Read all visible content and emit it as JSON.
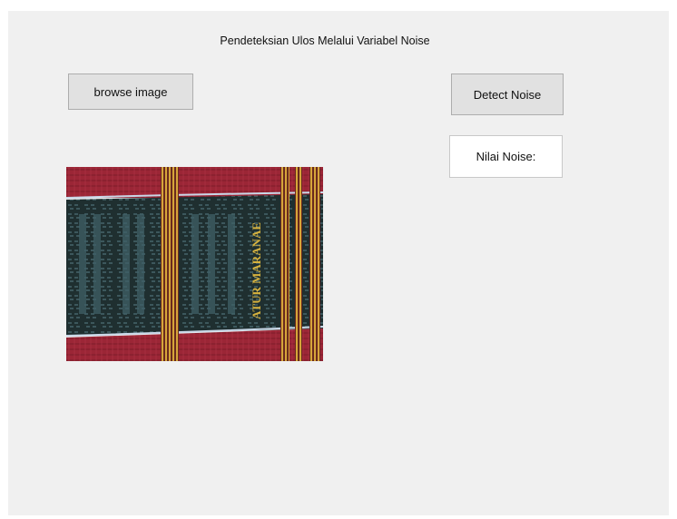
{
  "window": {
    "title": "Pendeteksian Ulos Melalui Variabel Noise"
  },
  "buttons": {
    "browse_label": "browse image",
    "detect_label": "Detect Noise"
  },
  "result": {
    "label": "Nilai Noise:"
  },
  "image": {
    "woven_text": "ATUR MARANAE",
    "colors": {
      "red_band": "#9b2636",
      "dark_band": "#1f2f30",
      "gold": "#d6a53a",
      "thread": "#c9d8e8"
    }
  }
}
